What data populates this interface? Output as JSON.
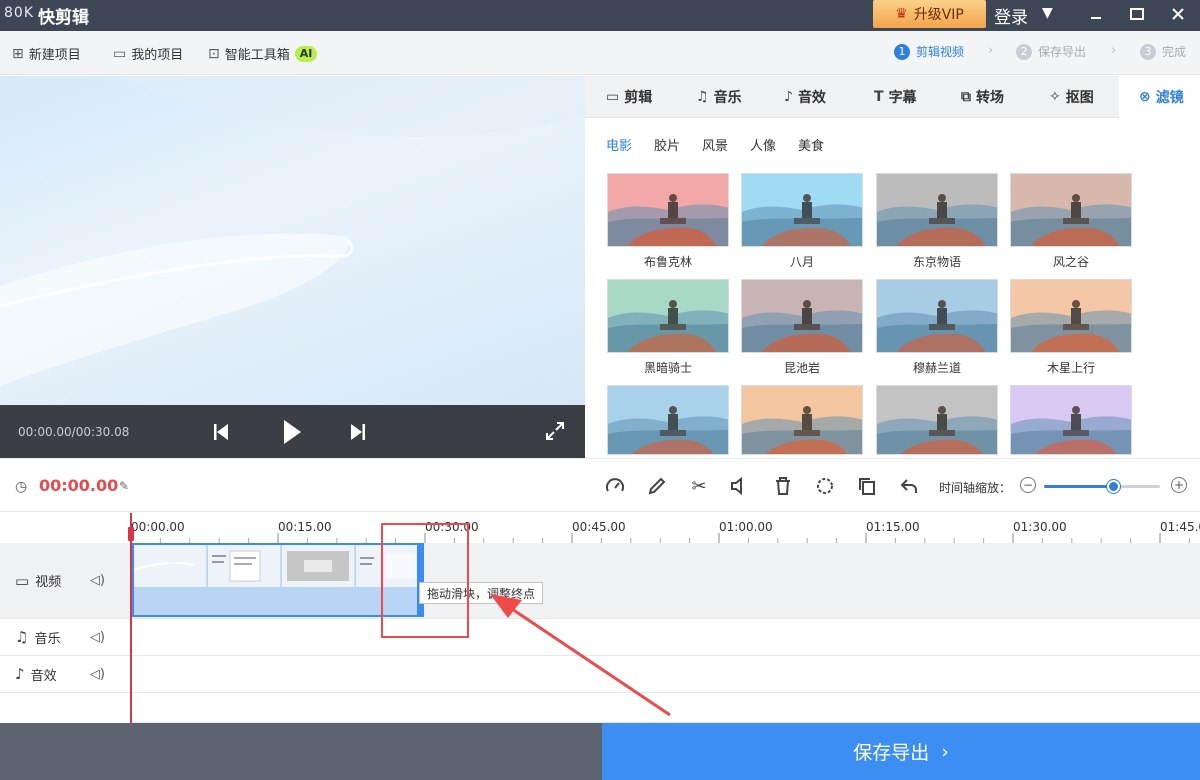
{
  "titlebar": {
    "logo": "80K",
    "app_title": "快剪辑",
    "vip_label": "升级VIP",
    "login_label": "登录",
    "icons": {
      "minimize": "minimize-icon",
      "maximize": "maximize-icon",
      "close": "close-icon"
    }
  },
  "menubar": {
    "items": [
      {
        "label": "新建项目",
        "icon": "new-project-icon"
      },
      {
        "label": "我的项目",
        "icon": "folder-icon"
      },
      {
        "label": "智能工具箱",
        "icon": "toolbox-icon"
      }
    ],
    "ai_badge": "AI",
    "steps": [
      {
        "num": "1",
        "label": "剪辑视频",
        "active": true
      },
      {
        "num": "2",
        "label": "保存导出",
        "active": false
      },
      {
        "num": "3",
        "label": "完成",
        "active": false
      }
    ]
  },
  "player": {
    "time": "00:00.00/00:30.08"
  },
  "tabs": [
    {
      "label": "剪辑",
      "icon": "video-icon"
    },
    {
      "label": "音乐",
      "icon": "music-icon"
    },
    {
      "label": "音效",
      "icon": "sound-effect-icon"
    },
    {
      "label": "字幕",
      "icon": "text-icon"
    },
    {
      "label": "转场",
      "icon": "transition-icon"
    },
    {
      "label": "抠图",
      "icon": "magic-icon"
    },
    {
      "label": "滤镜",
      "icon": "filter-icon",
      "active": true
    }
  ],
  "filters": {
    "categories": [
      "电影",
      "胶片",
      "风景",
      "人像",
      "美食"
    ],
    "active_category": "电影",
    "items": [
      {
        "label": "布鲁克林",
        "tint": "#f2a8a8"
      },
      {
        "label": "八月",
        "tint": "#9fdcf3"
      },
      {
        "label": "东京物语",
        "tint": "#bdbdbd"
      },
      {
        "label": "风之谷",
        "tint": "#d9b8ad"
      },
      {
        "label": "黑暗骑士",
        "tint": "#a9d9c6"
      },
      {
        "label": "昆池岩",
        "tint": "#c9b4b4"
      },
      {
        "label": "穆赫兰道",
        "tint": "#a7cde3"
      },
      {
        "label": "木星上行",
        "tint": "#f4c9a6"
      },
      {
        "label": "",
        "tint": "#a9d2ea"
      },
      {
        "label": "",
        "tint": "#f3c6a0"
      },
      {
        "label": "",
        "tint": "#c3c3c3"
      },
      {
        "label": "",
        "tint": "#d9c8f2"
      }
    ]
  },
  "timeline": {
    "current_time": "00:00.00",
    "zoom_label": "时间轴缩放：",
    "zoom_level": 0.6,
    "ruler": [
      "00:00.00",
      "00:15.00",
      "00:30.00",
      "00:45.00",
      "01:00.00",
      "01:15.00",
      "01:30.00",
      "01:45.00"
    ],
    "tracks": [
      {
        "label": "视频",
        "icon": "video-icon"
      },
      {
        "label": "音乐",
        "icon": "music-icon"
      },
      {
        "label": "音效",
        "icon": "sound-effect-icon"
      }
    ],
    "tooltip": "拖动滑块，调整终点"
  },
  "bottom": {
    "export_label": "保存导出"
  },
  "colors": {
    "accent": "#2f7fe0",
    "titlebar": "#3d4654",
    "playhead": "#d9354a",
    "annotation": "#ef4a4a"
  }
}
